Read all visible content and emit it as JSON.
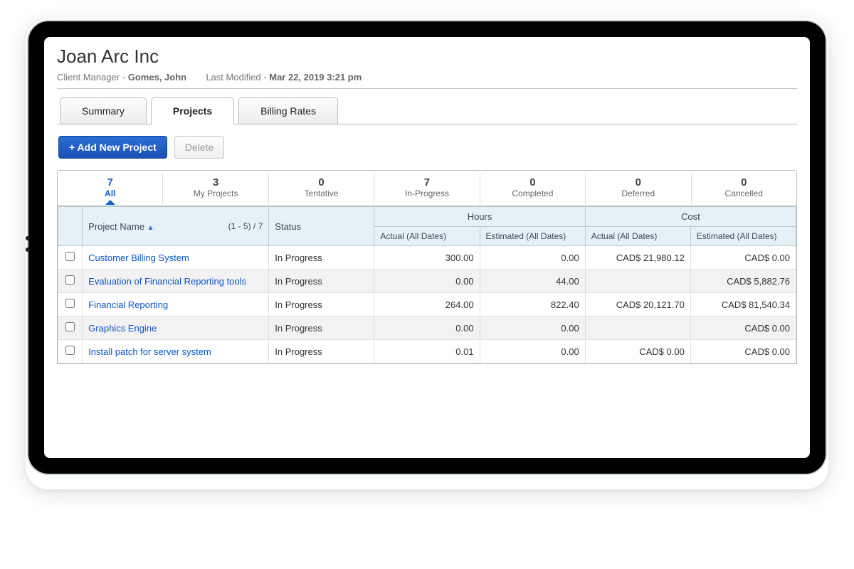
{
  "header": {
    "title": "Joan Arc Inc",
    "client_manager_label": "Client Manager -",
    "client_manager_value": "Gomes, John",
    "last_modified_label": "Last Modified -",
    "last_modified_value": "Mar 22, 2019 3:21 pm"
  },
  "tabs": {
    "summary": "Summary",
    "projects": "Projects",
    "billing_rates": "Billing Rates"
  },
  "toolbar": {
    "add_label": "+ Add New Project",
    "delete_label": "Delete"
  },
  "filters": {
    "all": {
      "count": "7",
      "label": "All"
    },
    "my": {
      "count": "3",
      "label": "My Projects"
    },
    "tentative": {
      "count": "0",
      "label": "Tentative"
    },
    "inprogress": {
      "count": "7",
      "label": "In-Progress"
    },
    "completed": {
      "count": "0",
      "label": "Completed"
    },
    "deferred": {
      "count": "0",
      "label": "Deferred"
    },
    "cancelled": {
      "count": "0",
      "label": "Cancelled"
    }
  },
  "columns": {
    "project_name": "Project Name",
    "page_range": "(1 - 5) / 7",
    "status": "Status",
    "hours_group": "Hours",
    "cost_group": "Cost",
    "actual": "Actual (All Dates)",
    "estimated": "Estimated (All Dates)"
  },
  "rows": [
    {
      "name": "Customer Billing System",
      "status": "In Progress",
      "h_act": "300.00",
      "h_est": "0.00",
      "c_act": "CAD$ 21,980.12",
      "c_est": "CAD$ 0.00"
    },
    {
      "name": "Evaluation of Financial Reporting tools",
      "status": "In Progress",
      "h_act": "0.00",
      "h_est": "44.00",
      "c_act": "",
      "c_est": "CAD$ 5,882.76"
    },
    {
      "name": "Financial Reporting",
      "status": "In Progress",
      "h_act": "264.00",
      "h_est": "822.40",
      "c_act": "CAD$ 20,121.70",
      "c_est": "CAD$ 81,540.34"
    },
    {
      "name": "Graphics Engine",
      "status": "In Progress",
      "h_act": "0.00",
      "h_est": "0.00",
      "c_act": "",
      "c_est": "CAD$ 0.00"
    },
    {
      "name": "Install patch for server system",
      "status": "In Progress",
      "h_act": "0.01",
      "h_est": "0.00",
      "c_act": "CAD$ 0.00",
      "c_est": "CAD$ 0.00"
    }
  ]
}
